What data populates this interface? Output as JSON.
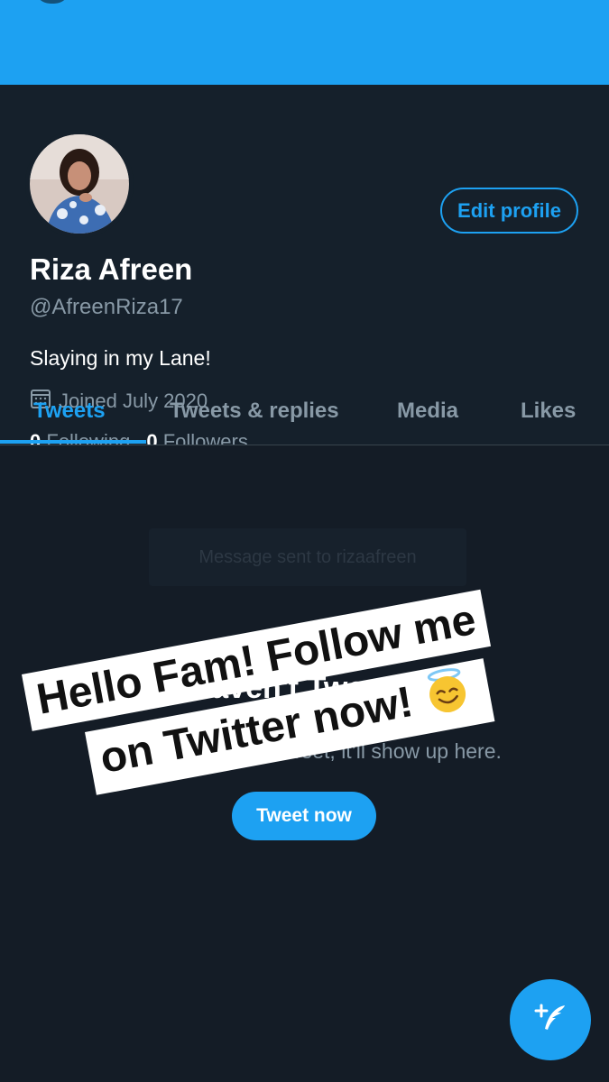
{
  "profile": {
    "name": "Riza Afreen",
    "handle": "@AfreenRiza17",
    "bio": "Slaying in my Lane!",
    "joined": "Joined July 2020",
    "following_count": "0",
    "following_label": "Following",
    "followers_count": "0",
    "followers_label": "Followers",
    "edit_label": "Edit profile"
  },
  "tabs": [
    "Tweets",
    "Tweets & replies",
    "Media",
    "Likes"
  ],
  "active_tab": "Tweets",
  "toast": "Message sent to rizaafreen",
  "empty_state": {
    "title": "You haven't Tweeted yet",
    "subtitle": "When you send a Tweet, it’ll show up here.",
    "button": "Tweet now"
  },
  "sticker": {
    "line1": "Hello Fam! Follow me",
    "line2": "on Twitter now!",
    "emoji": "smiling-face-with-halo"
  },
  "icons": {
    "calendar": "calendar-icon",
    "compose": "compose-tweet-icon"
  },
  "colors": {
    "accent": "#1da1f2",
    "background": "#15202b",
    "muted_text": "#8899a6"
  }
}
